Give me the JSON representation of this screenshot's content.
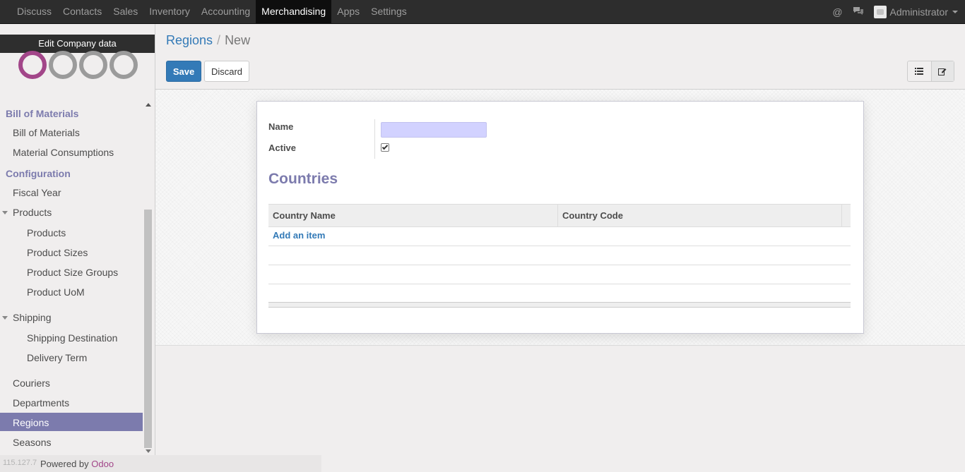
{
  "topbar": {
    "menu": [
      "Discuss",
      "Contacts",
      "Sales",
      "Inventory",
      "Accounting",
      "Merchandising",
      "Apps",
      "Settings"
    ],
    "active_menu": "Merchandising",
    "user": "Administrator"
  },
  "sidebar": {
    "edit_company": "Edit Company data",
    "sections": {
      "bom_header": "Bill of Materials",
      "bom_items": [
        "Bill of Materials",
        "Material Consumptions"
      ],
      "config_header": "Configuration",
      "fiscal_year": "Fiscal Year",
      "products": "Products",
      "products_children": [
        "Products",
        "Product Sizes",
        "Product Size Groups",
        "Product UoM"
      ],
      "shipping": "Shipping",
      "shipping_children": [
        "Shipping Destination",
        "Delivery Term"
      ],
      "couriers": "Couriers",
      "departments": "Departments",
      "regions": "Regions",
      "seasons": "Seasons"
    },
    "footer": {
      "ip": "115.127.7",
      "powered_by": "Powered by",
      "brand": "Odoo"
    }
  },
  "main": {
    "breadcrumb": {
      "parent": "Regions",
      "separator": "/",
      "current": "New"
    },
    "buttons": {
      "save": "Save",
      "discard": "Discard"
    },
    "form": {
      "name_label": "Name",
      "name_value": "",
      "active_label": "Active",
      "active_checked": true,
      "section_title": "Countries",
      "table": {
        "columns": [
          "Country Name",
          "Country Code"
        ],
        "add_item": "Add an item"
      }
    }
  },
  "colors": {
    "accent": "#7c7bad",
    "primary": "#337ab7",
    "brand": "#a24689"
  }
}
